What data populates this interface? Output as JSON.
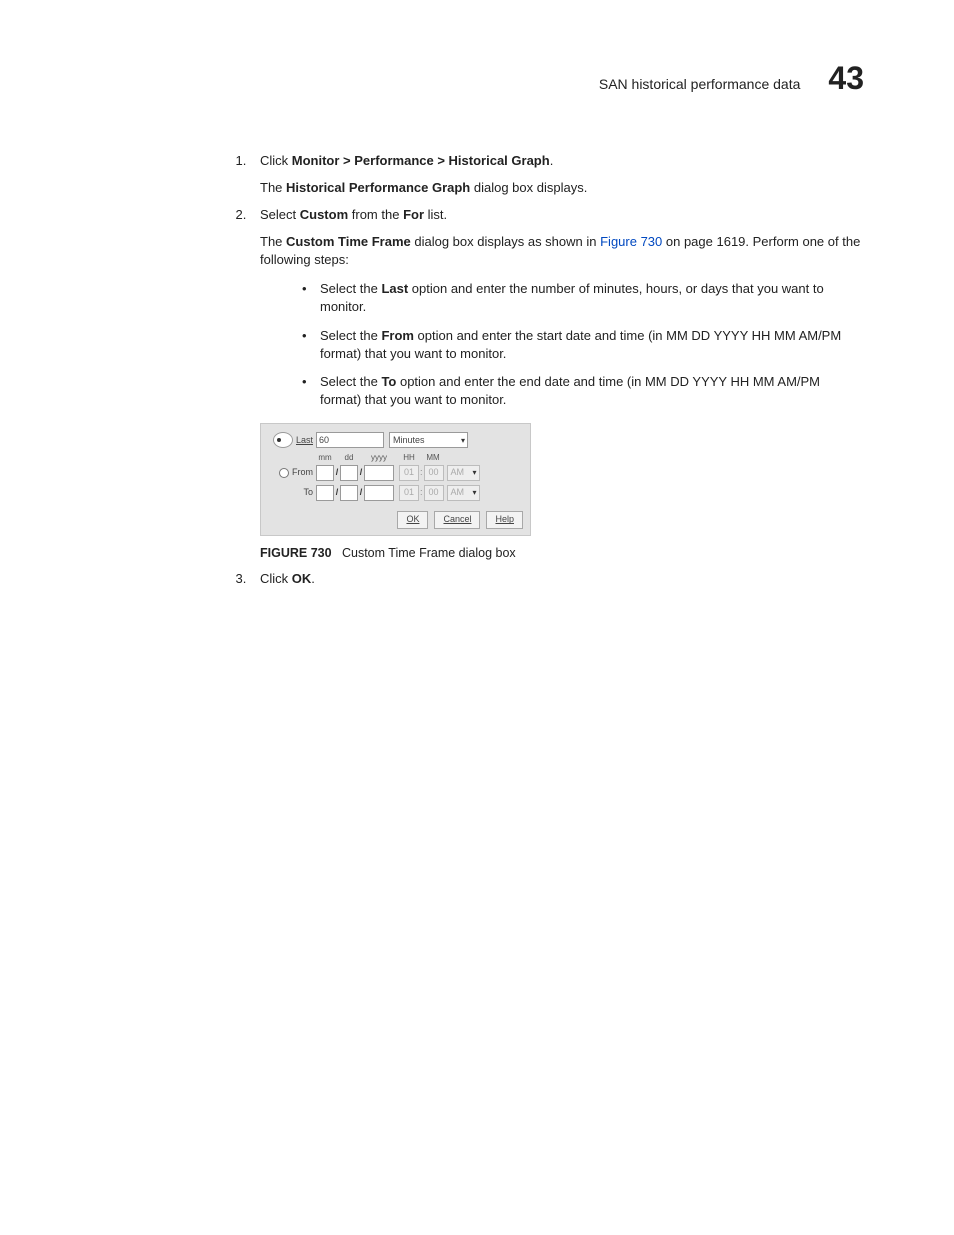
{
  "header": {
    "title": "SAN historical performance data",
    "chapter": "43"
  },
  "steps": {
    "s1": {
      "prefix": "Click ",
      "path_bold": "Monitor > Performance > Historical Graph",
      "suffix": ".",
      "p_prefix": "The ",
      "p_bold": "Historical Performance Graph",
      "p_suffix": " dialog box displays."
    },
    "s2": {
      "prefix": "Select ",
      "bold1": "Custom",
      "mid": " from the ",
      "bold2": "For",
      "suffix": " list.",
      "p_prefix": "The ",
      "p_bold": "Custom Time Frame",
      "p_mid": " dialog box displays as shown in ",
      "p_link": "Figure 730",
      "p_suffix": " on page 1619. Perform one of the following steps:",
      "bullets": {
        "b1_pre": "Select the ",
        "b1_bold": "Last",
        "b1_post": " option and enter the number of minutes, hours, or days that you want to monitor.",
        "b2_pre": "Select the ",
        "b2_bold": "From",
        "b2_post": " option and enter the start date and time (in MM DD YYYY HH MM AM/PM format) that you want to monitor.",
        "b3_pre": "Select the ",
        "b3_bold": "To",
        "b3_post": " option and enter the end date and time (in MM DD YYYY HH MM AM/PM format) that you want to monitor."
      }
    },
    "s3": {
      "prefix": "Click ",
      "bold": "OK",
      "suffix": "."
    }
  },
  "dialog": {
    "last_label": "Last",
    "last_value": "60",
    "units": "Minutes",
    "head": {
      "mm": "mm",
      "dd": "dd",
      "yyyy": "yyyy",
      "HH": "HH",
      "MM": "MM"
    },
    "from_label": "From",
    "to_label": "To",
    "sep": "/",
    "hh_val": "01",
    "mm_val": "00",
    "ampm": "AM",
    "ok": "OK",
    "cancel": "Cancel",
    "help": "Help"
  },
  "figure": {
    "num": "FIGURE 730",
    "caption": "Custom Time Frame dialog box"
  }
}
